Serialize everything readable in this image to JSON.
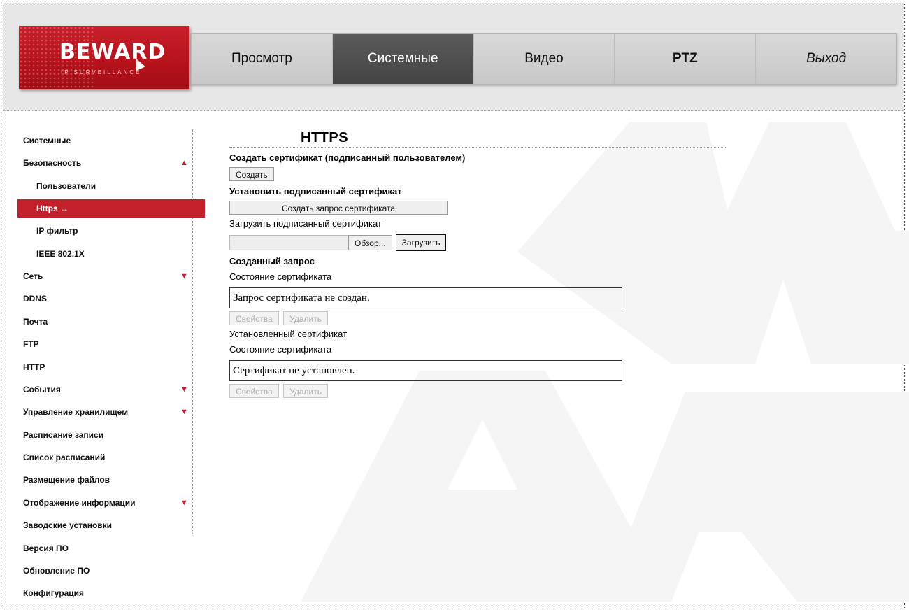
{
  "header": {
    "logo": {
      "brand": "BEWARD",
      "tagline": "IP SURVEILLANCE"
    },
    "nav": [
      {
        "label": "Просмотр",
        "active": false
      },
      {
        "label": "Системные",
        "active": true
      },
      {
        "label": "Видео",
        "active": false
      },
      {
        "label": "PTZ",
        "active": false
      },
      {
        "label": "Выход",
        "active": false
      }
    ]
  },
  "sidebar": {
    "items": [
      {
        "label": "Системные"
      },
      {
        "label": "Безопасность",
        "arrow": "▲"
      },
      {
        "label": "Пользователи"
      },
      {
        "label": "Https →"
      },
      {
        "label": "IP фильтр"
      },
      {
        "label": "IEEE 802.1X"
      },
      {
        "label": "Сеть",
        "arrow": "▼"
      },
      {
        "label": "DDNS"
      },
      {
        "label": "Почта"
      },
      {
        "label": "FTP"
      },
      {
        "label": "HTTP"
      },
      {
        "label": "События",
        "arrow": "▼"
      },
      {
        "label": "Управление хранилищем",
        "arrow": "▼"
      },
      {
        "label": "Расписание записи"
      },
      {
        "label": "Список расписаний"
      },
      {
        "label": "Размещение файлов"
      },
      {
        "label": "Отображение информации",
        "arrow": "▼"
      },
      {
        "label": "Заводские установки"
      },
      {
        "label": "Версия ПО"
      },
      {
        "label": "Обновление ПО"
      },
      {
        "label": "Конфигурация"
      }
    ]
  },
  "main": {
    "title": "HTTPS",
    "self_signed": {
      "heading": "Создать сертификат (подписанный пользователем)",
      "create_button": "Создать"
    },
    "signed": {
      "heading": "Установить подписанный сертификат",
      "request_button": "Создать запрос сертификата",
      "upload_label": "Загрузить подписанный сертификат",
      "browse_button": "Обзор...",
      "upload_button": "Загрузить"
    },
    "created_request": {
      "heading": "Созданный запрос",
      "status_label": "Состояние сертификата",
      "status_value": "Запрос сертификата не создан.",
      "properties_button": "Свойства",
      "delete_button": "Удалить"
    },
    "installed": {
      "heading": "Установленный сертификат",
      "status_label": "Состояние сертификата",
      "status_value": "Сертификат не установлен.",
      "properties_button": "Свойства",
      "delete_button": "Удалить"
    }
  },
  "colors": {
    "accent": "#c4202b",
    "active_tab": "#4a4a4a",
    "header_bg": "#e7e7e7"
  }
}
